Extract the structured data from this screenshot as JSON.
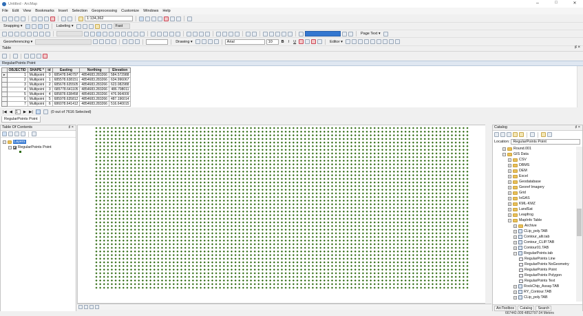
{
  "window": {
    "title": "Untitled - ArcMap",
    "minimize": "–",
    "maximize": "□",
    "close": "✕"
  },
  "menu": [
    "File",
    "Edit",
    "View",
    "Bookmarks",
    "Insert",
    "Selection",
    "Geoprocessing",
    "Customize",
    "Windows",
    "Help"
  ],
  "toolbar": {
    "scale": "1:134,362",
    "snapping": "Snapping ▾",
    "labeling": "Labeling ▾",
    "georeferencing": "Georeferencing ▾",
    "drawing": "Drawing ▾",
    "font": "Arial",
    "font_size": "10",
    "bold": "B",
    "italic": "I",
    "underline": "U",
    "editor": "Editor ▾",
    "page_text": "Page Text ▾",
    "fast": "Fast"
  },
  "table": {
    "header": "Table",
    "layer_title": "RegularPoints Point",
    "columns": [
      "OBJECTID",
      "SHAPE *",
      "id",
      "Easting",
      "Northing",
      "Elevation"
    ],
    "rows": [
      [
        "1",
        "Multipoint",
        "0",
        "685478.640797",
        "4854683.283266",
        "584.572988"
      ],
      [
        "2",
        "Multipoint",
        "1",
        "685578.638151",
        "4854683.283266",
        "634.996067"
      ],
      [
        "3",
        "Multipoint",
        "2",
        "685678.635505",
        "4854683.283266",
        "623.082988"
      ],
      [
        "4",
        "Multipoint",
        "3",
        "685778.641105",
        "4854683.283266",
        "486.798011"
      ],
      [
        "5",
        "Multipoint",
        "4",
        "685878.638458",
        "4854683.283266",
        "476.964009"
      ],
      [
        "6",
        "Multipoint",
        "5",
        "685978.635812",
        "4854683.283266",
        "487.196014"
      ],
      [
        "7",
        "Multipoint",
        "6",
        "686078.641412",
        "4854683.283266",
        "516.640015"
      ]
    ],
    "nav_first": "|◀",
    "nav_prev": "◀",
    "record": "1",
    "nav_next": "▶",
    "nav_last": "▶|",
    "selected_info": "(0 out of 7616 Selected)",
    "tab_label": "RegularPoints Point"
  },
  "toc": {
    "header": "Table Of Contents",
    "layers_label": "Layers",
    "layer_name": "RegularPoints Point"
  },
  "map": {
    "point_color": "#2f6b12",
    "cols": 97,
    "rows": 45
  },
  "catalog": {
    "header": "Catalog",
    "location_label": "Location:",
    "location_value": "RegularPoints Point",
    "tree": [
      {
        "label": "Round.001",
        "icon": "folder",
        "indent": 2
      },
      {
        "label": "GIS Data",
        "icon": "folder",
        "indent": 2
      },
      {
        "label": "CSV",
        "icon": "folder",
        "indent": 3
      },
      {
        "label": "DBMS",
        "icon": "folder",
        "indent": 3
      },
      {
        "label": "DEM",
        "icon": "folder",
        "indent": 3
      },
      {
        "label": "Excel",
        "icon": "folder",
        "indent": 3
      },
      {
        "label": "Geodatabase",
        "icon": "folder",
        "indent": 3
      },
      {
        "label": "Georef Imagery",
        "icon": "folder",
        "indent": 3
      },
      {
        "label": "Grid",
        "icon": "folder",
        "indent": 3
      },
      {
        "label": "IoGAS",
        "icon": "folder",
        "indent": 3
      },
      {
        "label": "KML-KMZ",
        "icon": "folder",
        "indent": 3
      },
      {
        "label": "LandSat",
        "icon": "folder",
        "indent": 3
      },
      {
        "label": "Leapfrog",
        "icon": "folder",
        "indent": 3
      },
      {
        "label": "MapInfo Table",
        "icon": "folder",
        "indent": 3
      },
      {
        "label": "Archive",
        "icon": "folder",
        "indent": 4
      },
      {
        "label": "CLip_poly.TAB",
        "icon": "table",
        "indent": 4
      },
      {
        "label": "Contour_alti.tab",
        "icon": "table",
        "indent": 4
      },
      {
        "label": "Contour_CLIP.TAB",
        "icon": "table",
        "indent": 4
      },
      {
        "label": "Contour01.TAB",
        "icon": "table",
        "indent": 4
      },
      {
        "label": "RegularPoints.tab",
        "icon": "table",
        "indent": 4
      },
      {
        "label": "RegularPoints Line",
        "icon": "layer",
        "indent": 5
      },
      {
        "label": "RegularPoints NoGeometry",
        "icon": "layer",
        "indent": 5
      },
      {
        "label": "RegularPoints Point",
        "icon": "layer",
        "indent": 5
      },
      {
        "label": "RegularPoints Polygon",
        "icon": "layer",
        "indent": 5
      },
      {
        "label": "RegularPoints Text",
        "icon": "layer",
        "indent": 5
      },
      {
        "label": "RockChip_Assay.TAB",
        "icon": "table",
        "indent": 4
      },
      {
        "label": "RY_Contour.TAB",
        "icon": "table",
        "indent": 4
      },
      {
        "label": "CLip_poly.TAB",
        "icon": "table",
        "indent": 4
      }
    ],
    "tabs": [
      "ArcToolbox",
      "Catalog",
      "Search"
    ]
  },
  "status": {
    "coords": "667442.009  4852797.04 Meters"
  }
}
